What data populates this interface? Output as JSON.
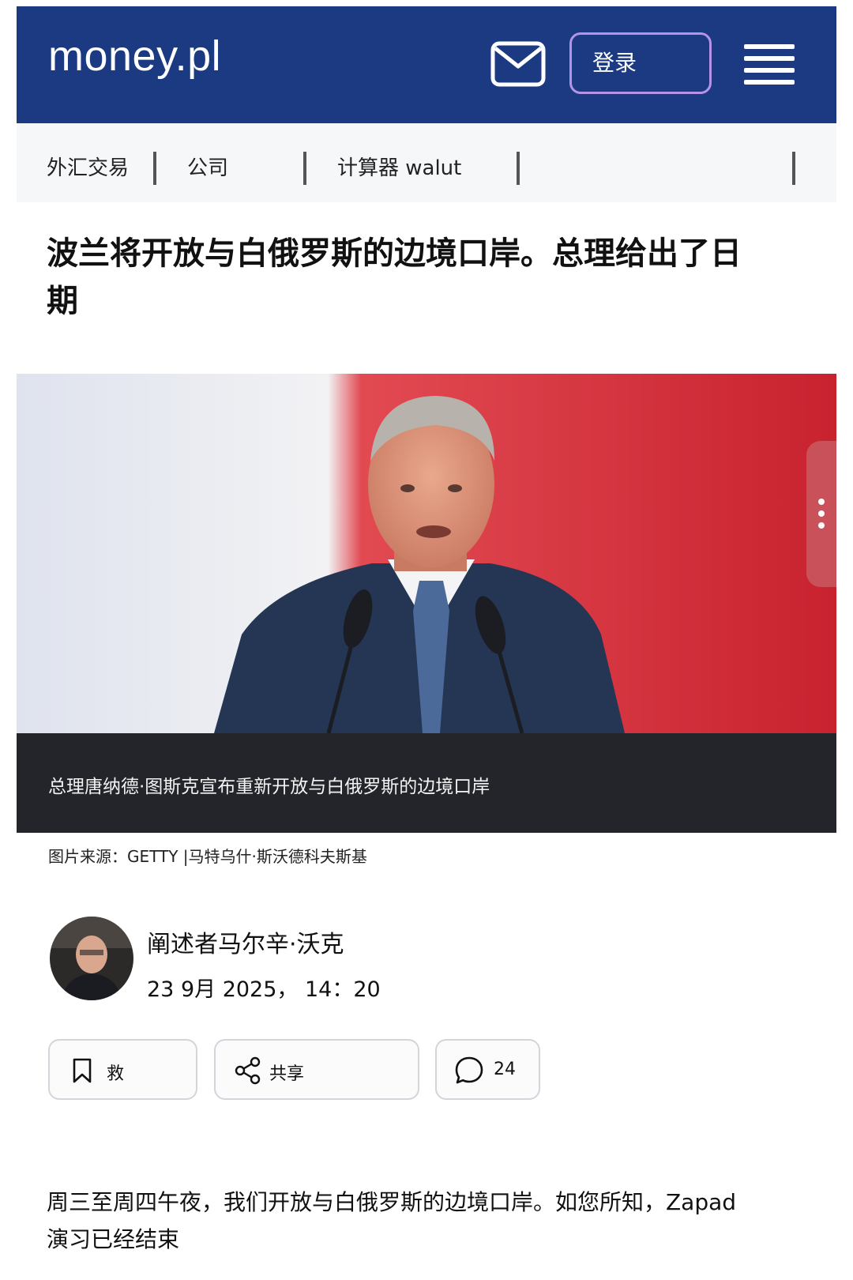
{
  "header": {
    "logo": "money.pl",
    "login_label": "登录",
    "bg_color": "#1b3a82",
    "icons": [
      "mail-icon",
      "menu-icon"
    ]
  },
  "nav": {
    "items": [
      {
        "label": "外汇交易"
      },
      {
        "label": "公司"
      },
      {
        "label": "计算器 walut"
      }
    ]
  },
  "article": {
    "title": "波兰将开放与白俄罗斯的边境口岸。总理给出了日期",
    "photo_caption": "总理唐纳德·图斯克宣布重新开放与白俄罗斯的边境口岸",
    "photo_credit": "图片来源：GETTY |马特乌什·斯沃德科夫斯基",
    "author": "阐述者马尔辛·沃克",
    "date": "23 9月 2025， 14：20",
    "actions": {
      "save_label": "救",
      "share_label": "共享",
      "comments_count": "24"
    },
    "body": "周三至周四午夜，我们开放与白俄罗斯的边境口岸。如您所知，Zapad 演习已经结束"
  }
}
